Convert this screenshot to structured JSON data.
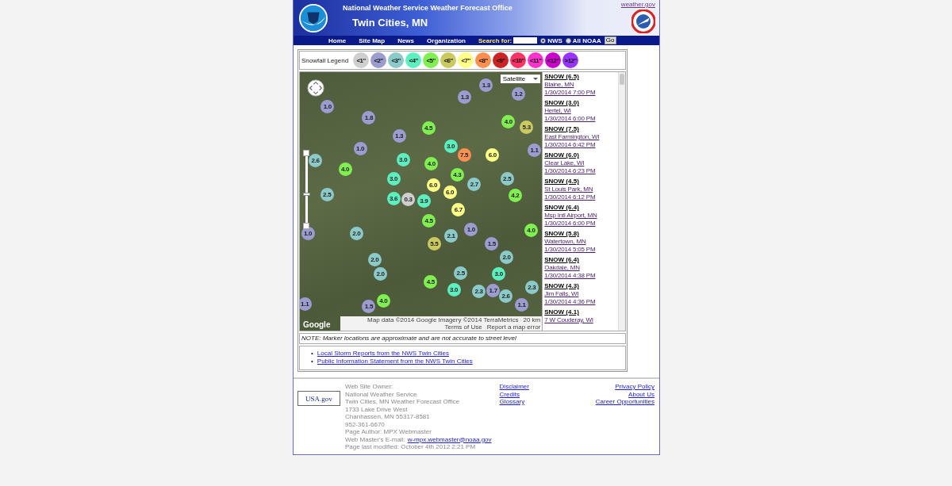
{
  "header": {
    "site_link": "weather.gov",
    "title": "National Weather Service Weather Forecast Office",
    "subtitle": "Twin Cities, MN"
  },
  "nav": {
    "links": [
      "Home",
      "Site Map",
      "News",
      "Organization"
    ],
    "search_label": "Search for:",
    "scopes": [
      {
        "label": "NWS",
        "selected": true
      },
      {
        "label": "All NOAA",
        "selected": false
      }
    ],
    "go": "Go"
  },
  "legend": {
    "label": "Snowfall Legend",
    "items": [
      {
        "label": "<1\"",
        "color": "#cfcfcf"
      },
      {
        "label": "<2\"",
        "color": "#9c9cd0"
      },
      {
        "label": "<3\"",
        "color": "#8ccaca"
      },
      {
        "label": "<4\"",
        "color": "#5cf0c0"
      },
      {
        "label": "<5\"",
        "color": "#80f050"
      },
      {
        "label": "<6\"",
        "color": "#caca60"
      },
      {
        "label": "<7\"",
        "color": "#ffff88"
      },
      {
        "label": "<8\"",
        "color": "#ff9050"
      },
      {
        "label": "<9\"",
        "color": "#cc2424"
      },
      {
        "label": "<10\"",
        "color": "#ff3366"
      },
      {
        "label": "<11\"",
        "color": "#ff33cc"
      },
      {
        "label": "<12\"",
        "color": "#cc00cc"
      },
      {
        "label": ">12\"",
        "color": "#9933ff"
      }
    ]
  },
  "map": {
    "type_menu": "Satellite",
    "zoom": {
      "level": 0.43
    },
    "attribution": "Map data ©2014 Google Imagery ©2014 TerraMetrics",
    "scale": "20 km",
    "terms": "Terms of Use",
    "report": "Report a map error",
    "logo": "Google",
    "markers": [
      {
        "value": "1.3",
        "color": "#9c9cd0"
      },
      {
        "value": "1.3",
        "color": "#9c9cd0"
      },
      {
        "value": "1.2",
        "color": "#9c9cd0"
      },
      {
        "value": "1.0",
        "color": "#9c9cd0"
      },
      {
        "value": "1.8",
        "color": "#9c9cd0"
      },
      {
        "value": "4.5",
        "color": "#80f050"
      },
      {
        "value": "4.0",
        "color": "#80f050"
      },
      {
        "value": "5.3",
        "color": "#caca60"
      },
      {
        "value": "2.6",
        "color": "#8ccaca"
      },
      {
        "value": "1.0",
        "color": "#9c9cd0"
      },
      {
        "value": "1.3",
        "color": "#9c9cd0"
      },
      {
        "value": "3.0",
        "color": "#5cf0c0"
      },
      {
        "value": "3.0",
        "color": "#5cf0c0"
      },
      {
        "value": "7.5",
        "color": "#ff9050"
      },
      {
        "value": "6.0",
        "color": "#ffff88"
      },
      {
        "value": "1.1",
        "color": "#9c9cd0"
      },
      {
        "value": "4.0",
        "color": "#80f050"
      },
      {
        "value": "3.0",
        "color": "#5cf0c0"
      },
      {
        "value": "4.0",
        "color": "#80f050"
      },
      {
        "value": "6.0",
        "color": "#ffff88"
      },
      {
        "value": "6.0",
        "color": "#ffff88"
      },
      {
        "value": "4.3",
        "color": "#80f050"
      },
      {
        "value": "2.7",
        "color": "#8ccaca"
      },
      {
        "value": "2.5",
        "color": "#8ccaca"
      },
      {
        "value": "2.5",
        "color": "#8ccaca"
      },
      {
        "value": "3.6",
        "color": "#5cf0c0"
      },
      {
        "value": "0.3",
        "color": "#cfcfcf"
      },
      {
        "value": "3.9",
        "color": "#5cf0c0"
      },
      {
        "value": "4.5",
        "color": "#80f050"
      },
      {
        "value": "6.7",
        "color": "#ffff88"
      },
      {
        "value": "4.2",
        "color": "#80f050"
      },
      {
        "value": "1.0",
        "color": "#9c9cd0"
      },
      {
        "value": "2.0",
        "color": "#8ccaca"
      },
      {
        "value": "5.5",
        "color": "#caca60"
      },
      {
        "value": "2.1",
        "color": "#8ccaca"
      },
      {
        "value": "1.0",
        "color": "#9c9cd0"
      },
      {
        "value": "1.5",
        "color": "#9c9cd0"
      },
      {
        "value": "4.0",
        "color": "#80f050"
      },
      {
        "value": "2.0",
        "color": "#8ccaca"
      },
      {
        "value": "2.0",
        "color": "#8ccaca"
      },
      {
        "value": "4.5",
        "color": "#80f050"
      },
      {
        "value": "2.5",
        "color": "#8ccaca"
      },
      {
        "value": "3.0",
        "color": "#5cf0c0"
      },
      {
        "value": "2.0",
        "color": "#8ccaca"
      },
      {
        "value": "1.1",
        "color": "#9c9cd0"
      },
      {
        "value": "4.0",
        "color": "#80f050"
      },
      {
        "value": "3.0",
        "color": "#5cf0c0"
      },
      {
        "value": "2.3",
        "color": "#8ccaca"
      },
      {
        "value": "1.7",
        "color": "#9c9cd0"
      },
      {
        "value": "2.6",
        "color": "#8ccaca"
      },
      {
        "value": "2.3",
        "color": "#8ccaca"
      },
      {
        "value": "1.5",
        "color": "#9c9cd0"
      },
      {
        "value": "1.1",
        "color": "#9c9cd0"
      }
    ]
  },
  "reports": [
    {
      "title": "SNOW (6.5)",
      "place": "Blaine, MN",
      "time": "1/30/2014 7:00 PM"
    },
    {
      "title": "SNOW (3.0)",
      "place": "Hertel, WI",
      "time": "1/30/2014 6:00 PM"
    },
    {
      "title": "SNOW (7.5)",
      "place": "East Farmington, WI",
      "time": "1/30/2014 6:42 PM"
    },
    {
      "title": "SNOW (6.0)",
      "place": "Clear Lake, WI",
      "time": "1/30/2014 6:23 PM"
    },
    {
      "title": "SNOW (4.5)",
      "place": "St Louis Park, MN",
      "time": "1/30/2014 6:12 PM"
    },
    {
      "title": "SNOW (6.4)",
      "place": "Msp Intl Airport, MN",
      "time": "1/30/2014 6:00 PM"
    },
    {
      "title": "SNOW (5.8)",
      "place": "Watertown, MN",
      "time": "1/30/2014 5:05 PM"
    },
    {
      "title": "SNOW (6.4)",
      "place": "Oakdale, MN",
      "time": "1/30/2014 4:38 PM"
    },
    {
      "title": "SNOW (4.3)",
      "place": "Jim Falls, WI",
      "time": "1/30/2014 4:36 PM"
    },
    {
      "title": "SNOW (4.1)",
      "place": "7 W Couderay, WI"
    }
  ],
  "note": "NOTE: Marker locations are approximate and are not accurate to street level",
  "links": [
    {
      "bullet": "•",
      "text": "Local Storm Reports from the NWS Twin Cities"
    },
    {
      "bullet": "•",
      "text": "Public Information Statement from the NWS Twin Cities"
    }
  ],
  "footer": {
    "badge": "USA.gov",
    "info": [
      "Web Site Owner:",
      "National Weather Service",
      "Twin Cities, MN Weather Forecast Office",
      "1733 Lake Drive West",
      "Chanhassen, MN 55317-8581",
      "952-361-6670",
      "Page Author: MPX Webmaster"
    ],
    "email_label": "Web Master's E-mail:",
    "email": "w-mpx.webmaster@noaa.gov",
    "modified": "Page last modified: October 4th 2012 2:21 PM",
    "links_mid": [
      "Disclaimer",
      "Credits",
      "Glossary"
    ],
    "links_right": [
      "Privacy Policy",
      "About Us",
      "Career Opportunities"
    ]
  }
}
